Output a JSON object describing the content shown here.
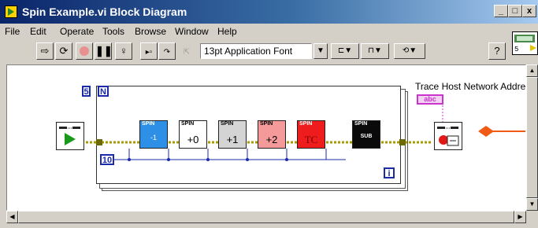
{
  "window": {
    "title": "Spin Example.vi Block Diagram",
    "minimize_label": "_",
    "maximize_label": "□",
    "close_label": "x"
  },
  "menu": {
    "items": [
      {
        "label": "File"
      },
      {
        "label": "Edit"
      },
      {
        "label": "Operate"
      },
      {
        "label": "Tools"
      },
      {
        "label": "Browse"
      },
      {
        "label": "Window"
      },
      {
        "label": "Help"
      }
    ]
  },
  "toolbar": {
    "font_label": "13pt Application Font",
    "help_label": "?"
  },
  "vi_icon": {
    "label": "5"
  },
  "diagram": {
    "loop_count": "5",
    "loop_n_label": "N",
    "loop_i_label": "i",
    "numeric_const": "10",
    "trace_label": "Trace Host Network Addre",
    "string_const": "abc",
    "spin_blocks": [
      {
        "label": "SPIN",
        "value": "-1",
        "color": "#2e8fe6"
      },
      {
        "label": "SPIN",
        "value": "+0",
        "color": "#ffffff"
      },
      {
        "label": "SPIN",
        "value": "+1",
        "color": "#d4d4d4"
      },
      {
        "label": "SPIN",
        "value": "+2",
        "color": "#f49a9a"
      },
      {
        "label": "SPIN",
        "value": "TC",
        "color": "#ee1c1c"
      },
      {
        "label": "SPIN",
        "value": "SUB",
        "color": "#0a0a0a"
      }
    ],
    "colors": {
      "wire_blue": "#1a2aa8",
      "wire_data": "#a89a00",
      "arrow_orange": "#f05a14"
    }
  }
}
